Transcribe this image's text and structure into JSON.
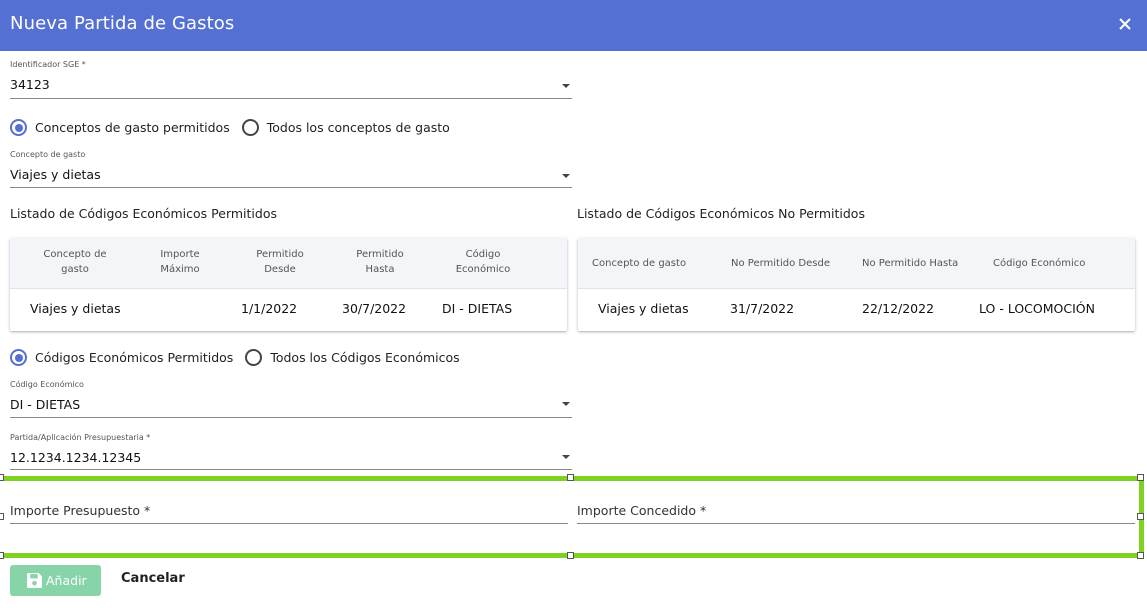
{
  "dialog": {
    "title": "Nueva Partida de Gastos",
    "close_icon": "close-icon"
  },
  "identificador": {
    "label": "Identificador SGE *",
    "value": "34123"
  },
  "concepto_radios": {
    "option_1": "Conceptos de gasto permitidos",
    "option_2": "Todos los conceptos de gasto",
    "selected": "option_1"
  },
  "concepto": {
    "label": "Concepto de gasto",
    "value": "Viajes y dietas"
  },
  "permitidos": {
    "title": "Listado de Códigos Económicos Permitidos",
    "headers": [
      [
        "Concepto de",
        "gasto"
      ],
      [
        "Importe",
        "Máximo"
      ],
      [
        "Permitido",
        "Desde"
      ],
      [
        "Permitido",
        "Hasta"
      ],
      [
        "Código",
        "Económico"
      ]
    ],
    "rows": [
      [
        "Viajes y dietas",
        "",
        "1/1/2022",
        "30/7/2022",
        "DI - DIETAS"
      ]
    ]
  },
  "no_permitidos": {
    "title": "Listado de Códigos Económicos No Permitidos",
    "headers": [
      "Concepto de gasto",
      "No Permitido Desde",
      "No Permitido Hasta",
      "Código Económico"
    ],
    "rows": [
      [
        "Viajes y dietas",
        "31/7/2022",
        "22/12/2022",
        "LO - LOCOMOCIÓN"
      ]
    ]
  },
  "codigo_radios": {
    "option_1": "Códigos Económicos Permitidos",
    "option_2": "Todos los Códigos Económicos",
    "selected": "option_1"
  },
  "codigo": {
    "label": "Código Económico",
    "value": "DI - DIETAS"
  },
  "partida": {
    "label": "Partida/Aplicación Presupuestaria *",
    "value": "12.1234.1234.12345"
  },
  "importes": {
    "presupuesto_placeholder": "Importe Presupuesto *",
    "concedido_placeholder": "Importe Concedido *"
  },
  "actions": {
    "add_label": "Añadir",
    "cancel_label": "Cancelar"
  },
  "colors": {
    "header": "#5470d3",
    "accent": "#5470d3",
    "selection": "#7ed321",
    "add_button": "#86d4a8"
  }
}
